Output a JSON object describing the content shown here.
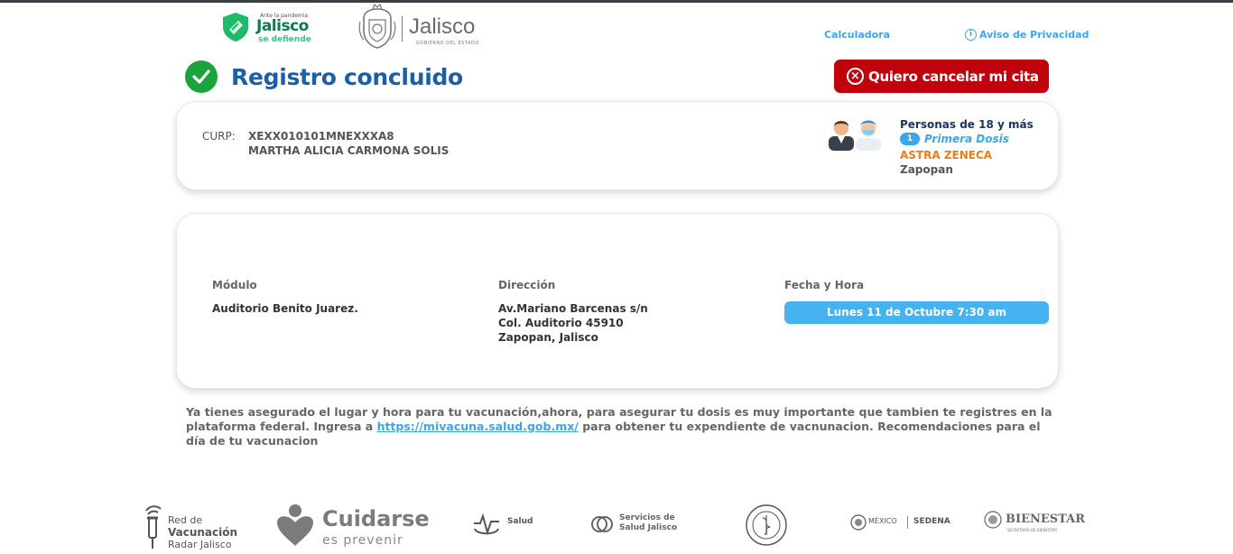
{
  "header": {
    "defiende_logo": {
      "tagline": "Ante la pandemia",
      "name": "Jalisco",
      "sub": "se defiende"
    },
    "jalisco_logo": {
      "name": "Jalisco",
      "sub": "GOBIERNO DEL ESTADO"
    },
    "links": {
      "calculator": "Calculadora",
      "privacy": "Aviso de Privacidad"
    }
  },
  "status": {
    "title": "Registro concluido",
    "icon": "check-circle-icon",
    "color": "#1ba33c"
  },
  "cancel_button": {
    "label": "Quiero cancelar mi cita",
    "color": "#c0020d"
  },
  "registrant": {
    "curp_label": "CURP:",
    "curp": "XEXX010101MNEXXXA8",
    "name": "MARTHA ALICIA CARMONA SOLIS"
  },
  "group": {
    "label": "Personas de 18 y más",
    "dose_number": "1",
    "dose_label": "Primera Dosis",
    "vaccine": "ASTRA ZENECA",
    "city": "Zapopan"
  },
  "appointment": {
    "module_label": "Módulo",
    "module": "Auditorio Benito Juarez.",
    "address_label": "Dirección",
    "address_lines": [
      "Av.Mariano Barcenas s/n",
      "Col. Auditorio 45910",
      "Zapopan, Jalisco"
    ],
    "datetime_label": "Fecha y Hora",
    "datetime": "Lunes 11 de Octubre 7:30 am"
  },
  "info": {
    "before_link": "Ya tienes asegurado el lugar y hora para tu vacunación,ahora, para asegurar tu dosis es muy importante que tambien te registres en la plataforma federal. Ingresa a ",
    "link": "https://mivacuna.salud.gob.mx/",
    "after_link": " para obtener tu expendiente de vacnunacion. Recomendaciones para el día de tu vacunacion"
  },
  "footer": {
    "red": {
      "line1": "Red de",
      "line2": "Vacunación",
      "line3": "Radar Jalisco"
    },
    "cuidarse": {
      "line1": "Cuidarse",
      "line2": "es prevenir"
    },
    "salud": "Salud",
    "servicios": {
      "line1": "Servicios de",
      "line2": "Salud Jalisco"
    },
    "gob": {
      "line1": "MÉXICO",
      "line2": "SEDENA"
    },
    "bienestar": {
      "line1": "BIENESTAR",
      "line2": "SECRETARÍA DE BIENESTAR"
    }
  }
}
